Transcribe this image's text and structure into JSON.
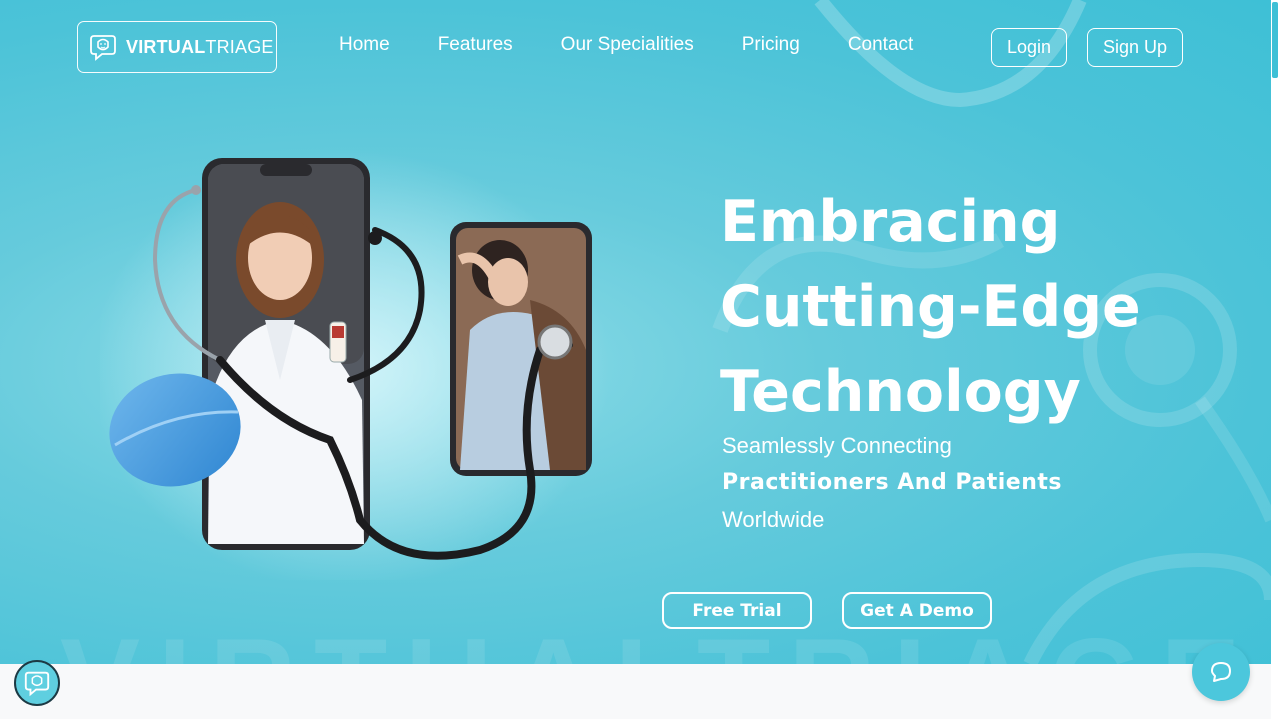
{
  "brand": {
    "name_bold": "VIRTUAL",
    "name_light": "TRIAGE",
    "logo_icon": "chat-bubble-face-icon"
  },
  "nav": {
    "items": [
      {
        "label": "Home"
      },
      {
        "label": "Features"
      },
      {
        "label": "Our Specialities"
      },
      {
        "label": "Pricing"
      },
      {
        "label": "Contact"
      }
    ],
    "login_label": "Login",
    "signup_label": "Sign Up"
  },
  "hero": {
    "headline": [
      "Embracing",
      "Cutting-Edge",
      "Technology"
    ],
    "subline_1": "Seamlessly Connecting",
    "subline_2": "Practitioners And Patients",
    "subline_3": "Worldwide",
    "cta_trial": "Free Trial",
    "cta_demo": "Get A Demo"
  },
  "widgets": {
    "chat_icon": "chat-bubble-icon",
    "avatar_icon": "chat-bubble-face-icon"
  },
  "colors": {
    "hero_bg": "#4cc3d8",
    "text": "#ffffff",
    "pill_blue": "#3d8fd6"
  }
}
